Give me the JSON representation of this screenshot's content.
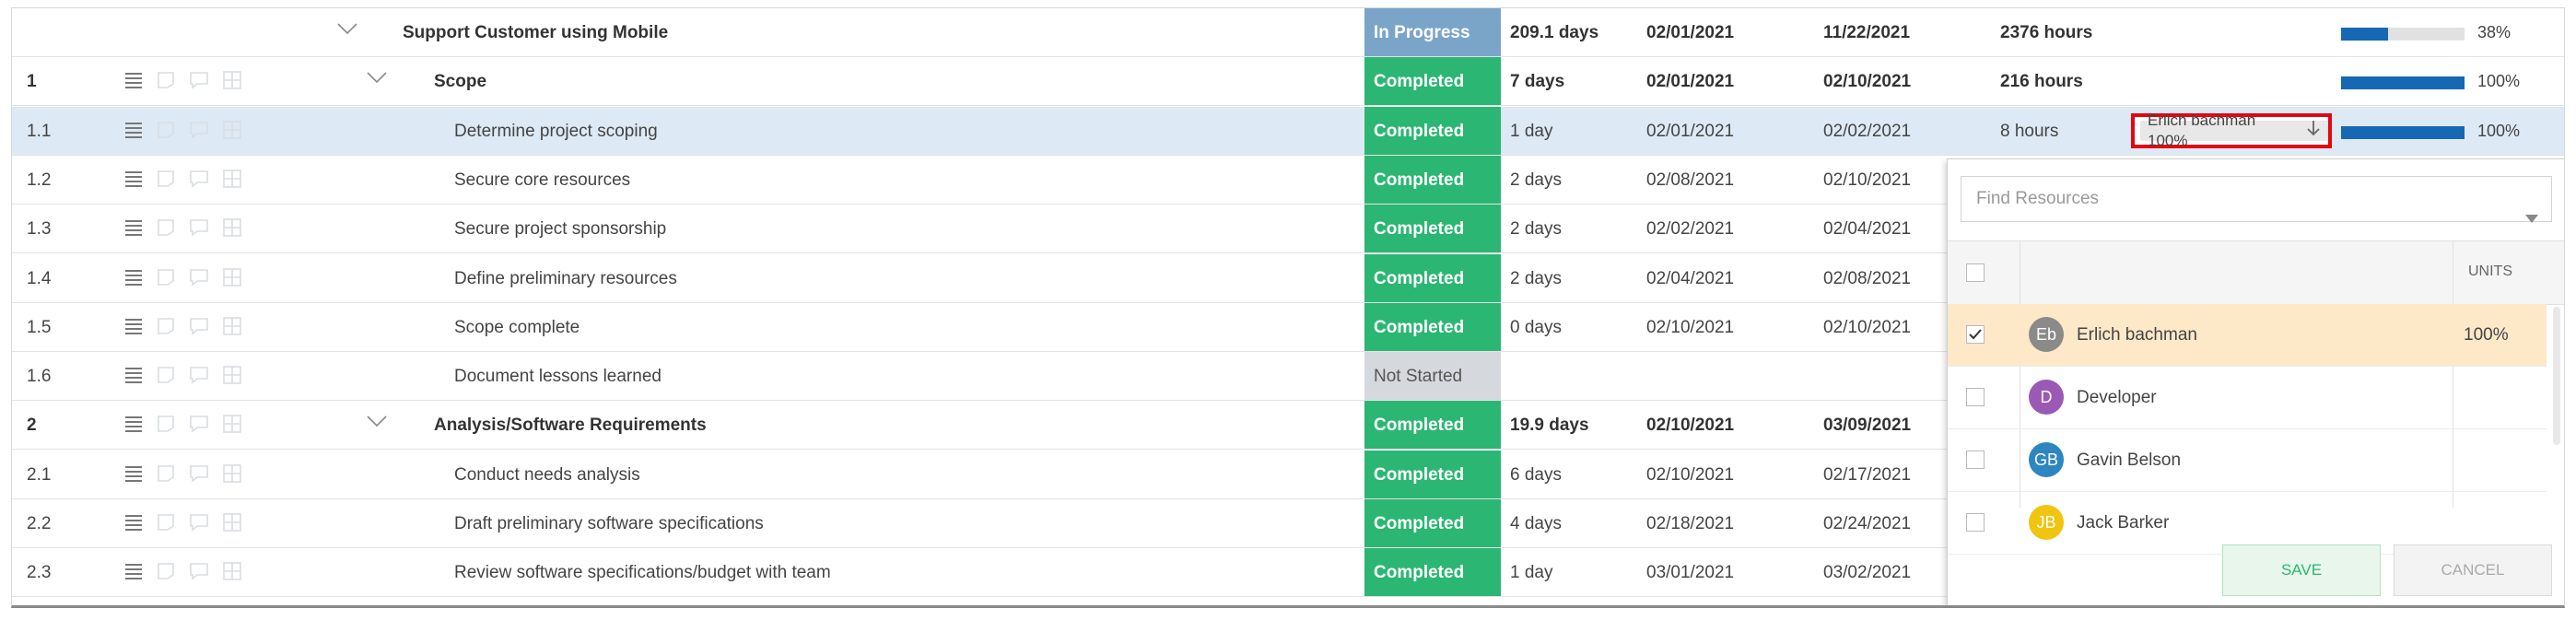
{
  "rows": [
    {
      "num": "",
      "name": "Support Customer using Mobile",
      "bold": true,
      "indent": 0,
      "chevron": true,
      "status": "In Progress",
      "status_kind": "inprogress",
      "duration": "209.1 days",
      "start": "02/01/2021",
      "finish": "11/22/2021",
      "work": "2376 hours",
      "progress": 38,
      "progress_label": "38%"
    },
    {
      "num": "1",
      "name": "Scope",
      "bold": true,
      "indent": 1,
      "chevron": true,
      "status": "Completed",
      "status_kind": "completed",
      "duration": "7 days",
      "start": "02/01/2021",
      "finish": "02/10/2021",
      "work": "216 hours",
      "progress": 100,
      "progress_label": "100%"
    },
    {
      "num": "1.1",
      "name": "Determine project scoping",
      "bold": false,
      "indent": 2,
      "chevron": false,
      "status": "Completed",
      "status_kind": "completed",
      "duration": "1 day",
      "start": "02/01/2021",
      "finish": "02/02/2021",
      "work": "8 hours",
      "progress": 100,
      "progress_label": "100%",
      "selected": true,
      "resource": "Erlich bachman 100%"
    },
    {
      "num": "1.2",
      "name": "Secure core resources",
      "bold": false,
      "indent": 2,
      "chevron": false,
      "status": "Completed",
      "status_kind": "completed",
      "duration": "2 days",
      "start": "02/08/2021",
      "finish": "02/10/2021"
    },
    {
      "num": "1.3",
      "name": "Secure project sponsorship",
      "bold": false,
      "indent": 2,
      "chevron": false,
      "status": "Completed",
      "status_kind": "completed",
      "duration": "2 days",
      "start": "02/02/2021",
      "finish": "02/04/2021"
    },
    {
      "num": "1.4",
      "name": "Define preliminary resources",
      "bold": false,
      "indent": 2,
      "chevron": false,
      "status": "Completed",
      "status_kind": "completed",
      "duration": "2 days",
      "start": "02/04/2021",
      "finish": "02/08/2021"
    },
    {
      "num": "1.5",
      "name": "Scope complete",
      "bold": false,
      "indent": 2,
      "chevron": false,
      "status": "Completed",
      "status_kind": "completed",
      "duration": "0 days",
      "start": "02/10/2021",
      "finish": "02/10/2021"
    },
    {
      "num": "1.6",
      "name": "Document lessons learned",
      "bold": false,
      "indent": 2,
      "chevron": false,
      "status": "Not Started",
      "status_kind": "notstarted",
      "duration": "",
      "start": "",
      "finish": ""
    },
    {
      "num": "2",
      "name": "Analysis/Software Requirements",
      "bold": true,
      "indent": 1,
      "chevron": true,
      "status": "Completed",
      "status_kind": "completed",
      "duration": "19.9 days",
      "start": "02/10/2021",
      "finish": "03/09/2021"
    },
    {
      "num": "2.1",
      "name": "Conduct needs analysis",
      "bold": false,
      "indent": 2,
      "chevron": false,
      "status": "Completed",
      "status_kind": "completed",
      "duration": "6 days",
      "start": "02/10/2021",
      "finish": "02/17/2021"
    },
    {
      "num": "2.2",
      "name": "Draft preliminary software specifications",
      "bold": false,
      "indent": 2,
      "chevron": false,
      "status": "Completed",
      "status_kind": "completed",
      "duration": "4 days",
      "start": "02/18/2021",
      "finish": "02/24/2021"
    },
    {
      "num": "2.3",
      "name": "Review software specifications/budget with team",
      "bold": false,
      "indent": 2,
      "chevron": false,
      "status": "Completed",
      "status_kind": "completed",
      "duration": "1 day",
      "start": "03/01/2021",
      "finish": "03/02/2021"
    }
  ],
  "colors": {
    "completed": "#2bb673",
    "in_progress": "#7aa5c9",
    "not_started": "#d5d8dc",
    "progress_fill": "#1668b3",
    "highlight_border": "#e30613",
    "selected_row": "#dde9f4",
    "selected_resource": "#fde8c8"
  },
  "resource_popup": {
    "search_placeholder": "Find Resources",
    "units_header": "UNITS",
    "resources": [
      {
        "initials": "Eb",
        "name": "Erlich bachman",
        "units": "100%",
        "checked": true,
        "avatar_color": "#8a8a8a"
      },
      {
        "initials": "D",
        "name": "Developer",
        "units": "",
        "checked": false,
        "avatar_color": "#9b59b6"
      },
      {
        "initials": "GB",
        "name": "Gavin Belson",
        "units": "",
        "checked": false,
        "avatar_color": "#2e86c1"
      },
      {
        "initials": "JB",
        "name": "Jack Barker",
        "units": "",
        "checked": false,
        "avatar_color": "#f1c40f"
      }
    ],
    "save_label": "SAVE",
    "cancel_label": "CANCEL"
  },
  "icons": [
    "menu-lines-icon",
    "note-icon",
    "comment-icon",
    "attachment-icon",
    "chevron-down-icon",
    "arrow-down-icon",
    "checkmark-icon"
  ]
}
